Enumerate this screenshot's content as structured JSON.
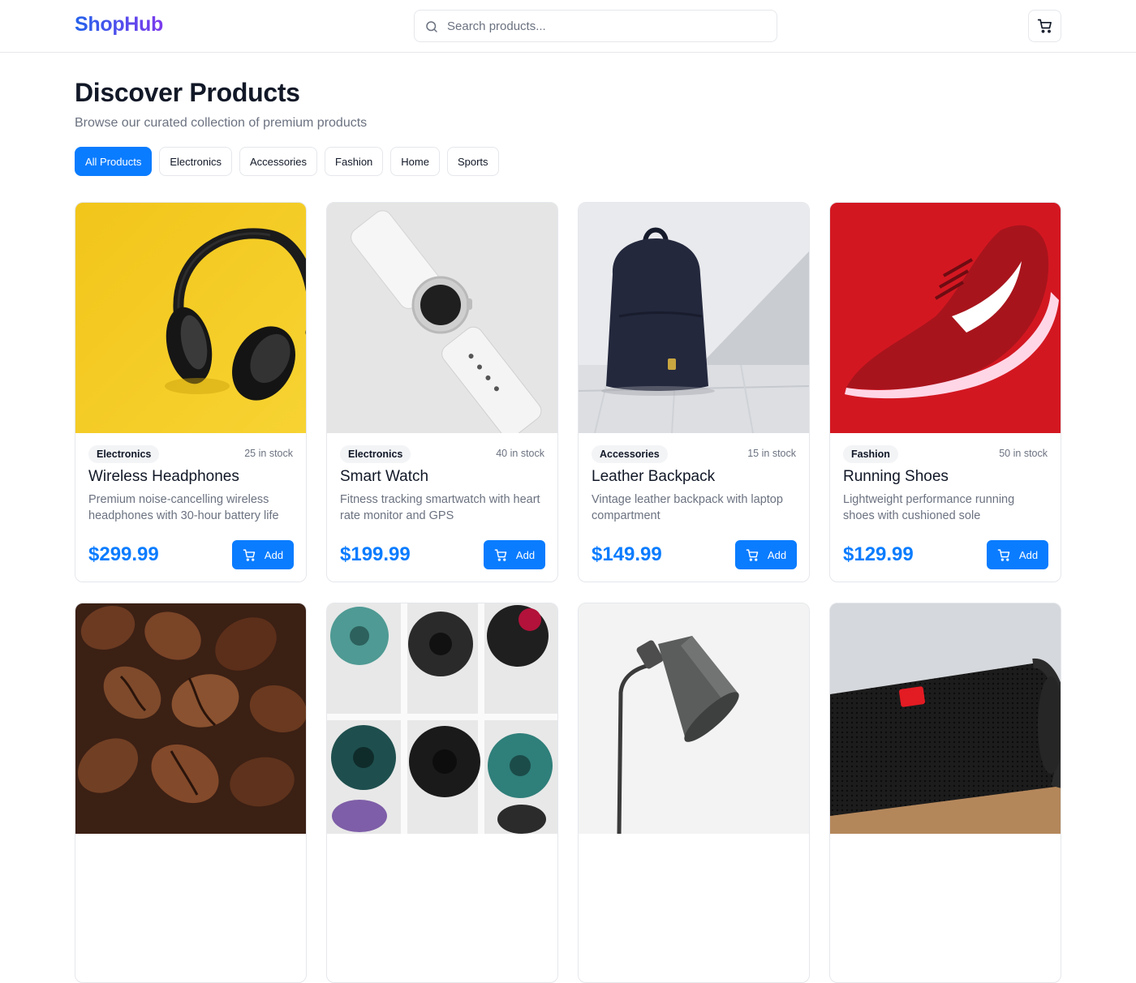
{
  "header": {
    "logo": "ShopHub",
    "search_placeholder": "Search products...",
    "cart_icon": "shopping-cart-icon",
    "logo_gradient": [
      "#2563eb",
      "#7c3aed"
    ]
  },
  "intro": {
    "title": "Discover Products",
    "subtitle": "Browse our curated collection of premium products"
  },
  "filters": [
    {
      "label": "All Products",
      "active": true
    },
    {
      "label": "Electronics",
      "active": false
    },
    {
      "label": "Accessories",
      "active": false
    },
    {
      "label": "Fashion",
      "active": false
    },
    {
      "label": "Home",
      "active": false
    },
    {
      "label": "Sports",
      "active": false
    }
  ],
  "theme": {
    "accent": "#0a7cff",
    "muted_text": "#6b7280",
    "border": "#e5e7eb"
  },
  "products": [
    {
      "name": "Wireless Headphones",
      "category": "Electronics",
      "stock": "25 in stock",
      "description": "Premium noise-cancelling wireless headphones with 30-hour battery life",
      "price": "$299.99",
      "add_label": "Add",
      "image": "headphones"
    },
    {
      "name": "Smart Watch",
      "category": "Electronics",
      "stock": "40 in stock",
      "description": "Fitness tracking smartwatch with heart rate monitor and GPS",
      "price": "$199.99",
      "add_label": "Add",
      "image": "smartwatch"
    },
    {
      "name": "Leather Backpack",
      "category": "Accessories",
      "stock": "15 in stock",
      "description": "Vintage leather backpack with laptop compartment",
      "price": "$149.99",
      "add_label": "Add",
      "image": "backpack"
    },
    {
      "name": "Running Shoes",
      "category": "Fashion",
      "stock": "50 in stock",
      "description": "Lightweight performance running shoes with cushioned sole",
      "price": "$129.99",
      "add_label": "Add",
      "image": "running-shoe"
    },
    {
      "image": "coffee-beans"
    },
    {
      "image": "yoga-mats"
    },
    {
      "image": "desk-lamp"
    },
    {
      "image": "bluetooth-speaker"
    }
  ]
}
